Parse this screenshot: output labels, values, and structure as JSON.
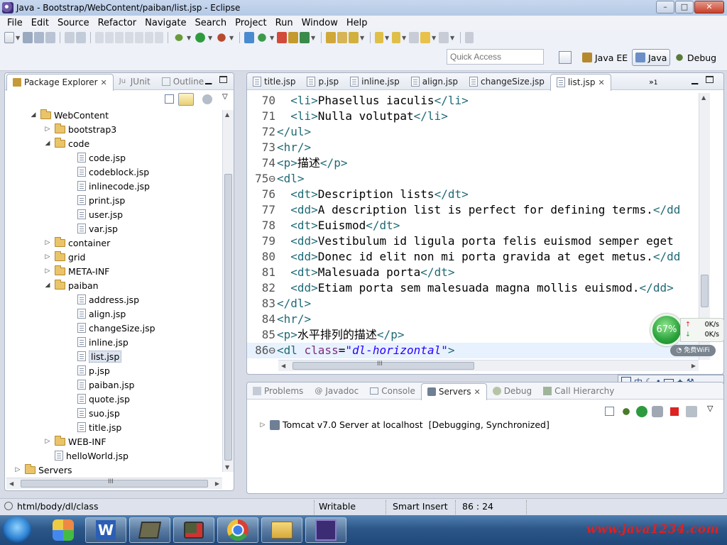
{
  "window": {
    "title": "Java - Bootstrap/WebContent/paiban/list.jsp - Eclipse",
    "buttons": {
      "minimize": "–",
      "maximize": "□",
      "close": "✕"
    }
  },
  "menu": [
    "File",
    "Edit",
    "Source",
    "Refactor",
    "Navigate",
    "Search",
    "Project",
    "Run",
    "Window",
    "Help"
  ],
  "quick_access": {
    "placeholder": "Quick Access"
  },
  "perspectives": [
    {
      "label": "Java EE",
      "active": false
    },
    {
      "label": "Java",
      "active": true
    },
    {
      "label": "Debug",
      "active": false
    }
  ],
  "left_panel": {
    "tabs": [
      {
        "label": "Package Explorer",
        "active": true
      },
      {
        "label": "JUnit",
        "active": false
      },
      {
        "label": "Outline",
        "active": false
      }
    ],
    "tree": [
      {
        "label": "WebContent",
        "type": "folder",
        "expanded": true,
        "depth": 0
      },
      {
        "label": "bootstrap3",
        "type": "folder",
        "expanded": false,
        "depth": 1
      },
      {
        "label": "code",
        "type": "folder",
        "expanded": true,
        "depth": 1
      },
      {
        "label": "code.jsp",
        "type": "file",
        "depth": 2
      },
      {
        "label": "codeblock.jsp",
        "type": "file",
        "depth": 2
      },
      {
        "label": "inlinecode.jsp",
        "type": "file",
        "depth": 2
      },
      {
        "label": "print.jsp",
        "type": "file",
        "depth": 2
      },
      {
        "label": "user.jsp",
        "type": "file",
        "depth": 2
      },
      {
        "label": "var.jsp",
        "type": "file",
        "depth": 2
      },
      {
        "label": "container",
        "type": "folder",
        "expanded": false,
        "depth": 1
      },
      {
        "label": "grid",
        "type": "folder",
        "expanded": false,
        "depth": 1
      },
      {
        "label": "META-INF",
        "type": "folder",
        "expanded": false,
        "depth": 1
      },
      {
        "label": "paiban",
        "type": "folder",
        "expanded": true,
        "depth": 1
      },
      {
        "label": "address.jsp",
        "type": "file",
        "depth": 2
      },
      {
        "label": "align.jsp",
        "type": "file",
        "depth": 2
      },
      {
        "label": "changeSize.jsp",
        "type": "file",
        "depth": 2
      },
      {
        "label": "inline.jsp",
        "type": "file",
        "depth": 2
      },
      {
        "label": "list.jsp",
        "type": "file",
        "depth": 2,
        "selected": true
      },
      {
        "label": "p.jsp",
        "type": "file",
        "depth": 2
      },
      {
        "label": "paiban.jsp",
        "type": "file",
        "depth": 2
      },
      {
        "label": "quote.jsp",
        "type": "file",
        "depth": 2
      },
      {
        "label": "suo.jsp",
        "type": "file",
        "depth": 2
      },
      {
        "label": "title.jsp",
        "type": "file",
        "depth": 2
      },
      {
        "label": "WEB-INF",
        "type": "folder",
        "expanded": false,
        "depth": 1
      },
      {
        "label": "helloWorld.jsp",
        "type": "file",
        "depth": 1
      },
      {
        "label": "Servers",
        "type": "folder",
        "expanded": false,
        "depth": -1
      }
    ],
    "hscroll_grip": "III"
  },
  "editor": {
    "tabs": [
      "title.jsp",
      "p.jsp",
      "inline.jsp",
      "align.jsp",
      "changeSize.jsp",
      "list.jsp"
    ],
    "active_tab": "list.jsp",
    "overflow_count": "1",
    "lines": [
      {
        "n": "70",
        "parts": [
          [
            "  ",
            "txt"
          ],
          [
            "<li>",
            "tag"
          ],
          [
            "Phasellus iaculis",
            "txt"
          ],
          [
            "</li>",
            "tag"
          ]
        ]
      },
      {
        "n": "71",
        "parts": [
          [
            "  ",
            "txt"
          ],
          [
            "<li>",
            "tag"
          ],
          [
            "Nulla volutpat",
            "txt"
          ],
          [
            "</li>",
            "tag"
          ]
        ]
      },
      {
        "n": "72",
        "parts": [
          [
            "</ul>",
            "tag"
          ]
        ]
      },
      {
        "n": "73",
        "parts": [
          [
            "<hr/>",
            "tag"
          ]
        ]
      },
      {
        "n": "74",
        "parts": [
          [
            "<p>",
            "tag"
          ],
          [
            "描述",
            "txt"
          ],
          [
            "</p>",
            "tag"
          ]
        ]
      },
      {
        "n": "75⊖",
        "parts": [
          [
            "<dl>",
            "tag"
          ]
        ]
      },
      {
        "n": "76",
        "parts": [
          [
            "  ",
            "txt"
          ],
          [
            "<dt>",
            "tag"
          ],
          [
            "Description lists",
            "txt"
          ],
          [
            "</dt>",
            "tag"
          ]
        ]
      },
      {
        "n": "77",
        "parts": [
          [
            "  ",
            "txt"
          ],
          [
            "<dd>",
            "tag"
          ],
          [
            "A description list is perfect for defining terms.",
            "txt"
          ],
          [
            "</dd",
            "tag"
          ]
        ]
      },
      {
        "n": "78",
        "parts": [
          [
            "  ",
            "txt"
          ],
          [
            "<dt>",
            "tag"
          ],
          [
            "Euismod",
            "txt"
          ],
          [
            "</dt>",
            "tag"
          ]
        ]
      },
      {
        "n": "79",
        "parts": [
          [
            "  ",
            "txt"
          ],
          [
            "<dd>",
            "tag"
          ],
          [
            "Vestibulum id ligula porta felis euismod semper eget",
            "txt"
          ]
        ]
      },
      {
        "n": "80",
        "parts": [
          [
            "  ",
            "txt"
          ],
          [
            "<dd>",
            "tag"
          ],
          [
            "Donec id elit non mi porta gravida at eget metus.",
            "txt"
          ],
          [
            "</dd",
            "tag"
          ]
        ]
      },
      {
        "n": "81",
        "parts": [
          [
            "  ",
            "txt"
          ],
          [
            "<dt>",
            "tag"
          ],
          [
            "Malesuada porta",
            "txt"
          ],
          [
            "</dt>",
            "tag"
          ]
        ]
      },
      {
        "n": "82",
        "parts": [
          [
            "  ",
            "txt"
          ],
          [
            "<dd>",
            "tag"
          ],
          [
            "Etiam porta sem malesuada magna mollis euismod.",
            "txt"
          ],
          [
            "</dd>",
            "tag"
          ]
        ]
      },
      {
        "n": "83",
        "parts": [
          [
            "</dl>",
            "tag"
          ]
        ]
      },
      {
        "n": "84",
        "parts": [
          [
            "<hr/>",
            "tag"
          ]
        ]
      },
      {
        "n": "85",
        "parts": [
          [
            "<p>",
            "tag"
          ],
          [
            "水平排列的描述",
            "txt"
          ],
          [
            "</p>",
            "tag"
          ]
        ]
      },
      {
        "n": "86⊖",
        "parts": [
          [
            "<dl ",
            "tag"
          ],
          [
            "class",
            "attr"
          ],
          [
            "=",
            "txt"
          ],
          [
            "\"dl-horizontal\"",
            "val"
          ],
          [
            ">",
            "tag"
          ]
        ],
        "current": true
      }
    ],
    "hscroll_grip": "III"
  },
  "bottom_panel": {
    "tabs": [
      {
        "label": "Problems",
        "active": false
      },
      {
        "label": "Javadoc",
        "active": false
      },
      {
        "label": "Console",
        "active": false
      },
      {
        "label": "Servers",
        "active": true
      },
      {
        "label": "Debug",
        "active": false
      },
      {
        "label": "Call Hierarchy",
        "active": false
      }
    ],
    "server": {
      "name": "Tomcat v7.0 Server at localhost",
      "status": "[Debugging, Synchronized]"
    }
  },
  "status_bar": {
    "path": "html/body/dl/class",
    "mode": "Writable",
    "insert": "Smart Insert",
    "position": "86 : 24"
  },
  "net_widget": {
    "percent": "67%",
    "up": "0K/s",
    "down": "0K/s",
    "wifi": "免费WiFi"
  },
  "ime": {
    "lang": "中"
  },
  "taskbar": {
    "watermark": "www.java1234.com"
  },
  "colors": {
    "tag": "#1e6a76",
    "attr": "#7d2a7d",
    "value": "#2a00ff",
    "current_line": "#e8f2fe"
  }
}
